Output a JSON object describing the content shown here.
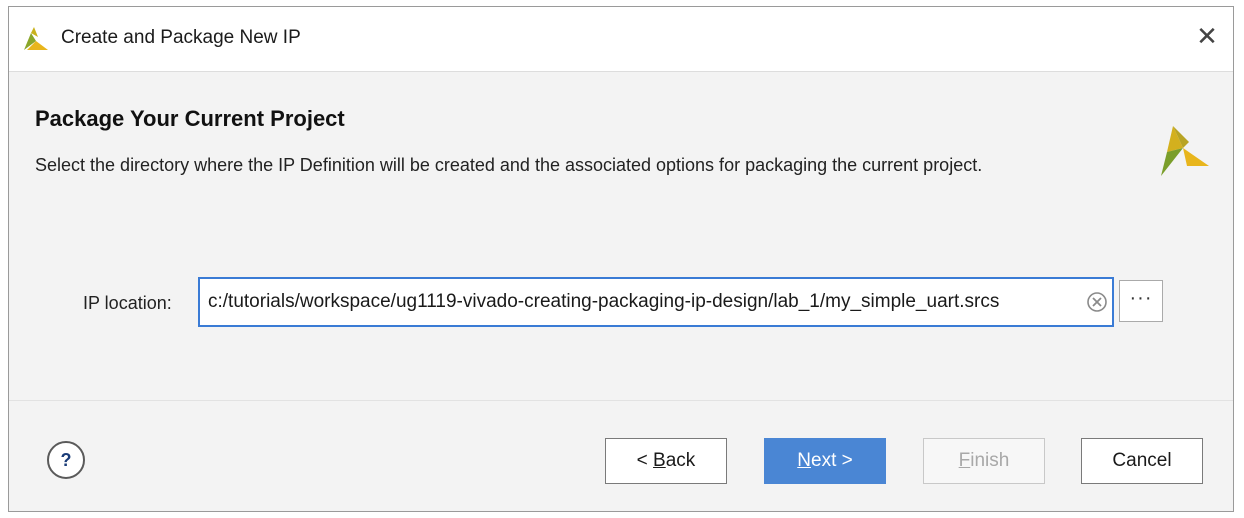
{
  "window": {
    "title": "Create and Package New IP",
    "close_glyph": "✕",
    "logo_icon": "vivado-logo-icon"
  },
  "page": {
    "heading": "Package Your Current Project",
    "description": "Select the directory where the IP Definition will be created and the associated options for packaging the current project."
  },
  "ip_location": {
    "label": "IP location:",
    "value": "c:/tutorials/workspace/ug1119-vivado-creating-packaging-ip-design/lab_1/my_simple_uart.srcs",
    "browse_label": "···"
  },
  "footer": {
    "help_label": "?",
    "back": {
      "prefix": "< ",
      "mnemonic": "B",
      "rest": "ack"
    },
    "next": {
      "mnemonic": "N",
      "rest": "ext >"
    },
    "finish": {
      "mnemonic": "F",
      "rest": "inish",
      "enabled": false
    },
    "cancel": "Cancel"
  },
  "colors": {
    "accent": "#4a86d4",
    "field_border": "#3a7bd5",
    "logo_green": "#8aa62a",
    "logo_yellow": "#e8b51c"
  }
}
